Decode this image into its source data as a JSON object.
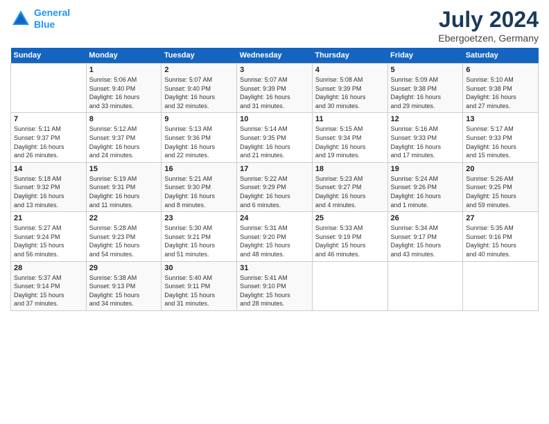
{
  "header": {
    "logo_line1": "General",
    "logo_line2": "Blue",
    "title": "July 2024",
    "subtitle": "Ebergoetzen, Germany"
  },
  "days_of_week": [
    "Sunday",
    "Monday",
    "Tuesday",
    "Wednesday",
    "Thursday",
    "Friday",
    "Saturday"
  ],
  "weeks": [
    [
      {
        "day": "",
        "info": ""
      },
      {
        "day": "1",
        "info": "Sunrise: 5:06 AM\nSunset: 9:40 PM\nDaylight: 16 hours\nand 33 minutes."
      },
      {
        "day": "2",
        "info": "Sunrise: 5:07 AM\nSunset: 9:40 PM\nDaylight: 16 hours\nand 32 minutes."
      },
      {
        "day": "3",
        "info": "Sunrise: 5:07 AM\nSunset: 9:39 PM\nDaylight: 16 hours\nand 31 minutes."
      },
      {
        "day": "4",
        "info": "Sunrise: 5:08 AM\nSunset: 9:39 PM\nDaylight: 16 hours\nand 30 minutes."
      },
      {
        "day": "5",
        "info": "Sunrise: 5:09 AM\nSunset: 9:38 PM\nDaylight: 16 hours\nand 29 minutes."
      },
      {
        "day": "6",
        "info": "Sunrise: 5:10 AM\nSunset: 9:38 PM\nDaylight: 16 hours\nand 27 minutes."
      }
    ],
    [
      {
        "day": "7",
        "info": "Sunrise: 5:11 AM\nSunset: 9:37 PM\nDaylight: 16 hours\nand 26 minutes."
      },
      {
        "day": "8",
        "info": "Sunrise: 5:12 AM\nSunset: 9:37 PM\nDaylight: 16 hours\nand 24 minutes."
      },
      {
        "day": "9",
        "info": "Sunrise: 5:13 AM\nSunset: 9:36 PM\nDaylight: 16 hours\nand 22 minutes."
      },
      {
        "day": "10",
        "info": "Sunrise: 5:14 AM\nSunset: 9:35 PM\nDaylight: 16 hours\nand 21 minutes."
      },
      {
        "day": "11",
        "info": "Sunrise: 5:15 AM\nSunset: 9:34 PM\nDaylight: 16 hours\nand 19 minutes."
      },
      {
        "day": "12",
        "info": "Sunrise: 5:16 AM\nSunset: 9:33 PM\nDaylight: 16 hours\nand 17 minutes."
      },
      {
        "day": "13",
        "info": "Sunrise: 5:17 AM\nSunset: 9:33 PM\nDaylight: 16 hours\nand 15 minutes."
      }
    ],
    [
      {
        "day": "14",
        "info": "Sunrise: 5:18 AM\nSunset: 9:32 PM\nDaylight: 16 hours\nand 13 minutes."
      },
      {
        "day": "15",
        "info": "Sunrise: 5:19 AM\nSunset: 9:31 PM\nDaylight: 16 hours\nand 11 minutes."
      },
      {
        "day": "16",
        "info": "Sunrise: 5:21 AM\nSunset: 9:30 PM\nDaylight: 16 hours\nand 8 minutes."
      },
      {
        "day": "17",
        "info": "Sunrise: 5:22 AM\nSunset: 9:29 PM\nDaylight: 16 hours\nand 6 minutes."
      },
      {
        "day": "18",
        "info": "Sunrise: 5:23 AM\nSunset: 9:27 PM\nDaylight: 16 hours\nand 4 minutes."
      },
      {
        "day": "19",
        "info": "Sunrise: 5:24 AM\nSunset: 9:26 PM\nDaylight: 16 hours\nand 1 minute."
      },
      {
        "day": "20",
        "info": "Sunrise: 5:26 AM\nSunset: 9:25 PM\nDaylight: 15 hours\nand 59 minutes."
      }
    ],
    [
      {
        "day": "21",
        "info": "Sunrise: 5:27 AM\nSunset: 9:24 PM\nDaylight: 15 hours\nand 56 minutes."
      },
      {
        "day": "22",
        "info": "Sunrise: 5:28 AM\nSunset: 9:23 PM\nDaylight: 15 hours\nand 54 minutes."
      },
      {
        "day": "23",
        "info": "Sunrise: 5:30 AM\nSunset: 9:21 PM\nDaylight: 15 hours\nand 51 minutes."
      },
      {
        "day": "24",
        "info": "Sunrise: 5:31 AM\nSunset: 9:20 PM\nDaylight: 15 hours\nand 48 minutes."
      },
      {
        "day": "25",
        "info": "Sunrise: 5:33 AM\nSunset: 9:19 PM\nDaylight: 15 hours\nand 46 minutes."
      },
      {
        "day": "26",
        "info": "Sunrise: 5:34 AM\nSunset: 9:17 PM\nDaylight: 15 hours\nand 43 minutes."
      },
      {
        "day": "27",
        "info": "Sunrise: 5:35 AM\nSunset: 9:16 PM\nDaylight: 15 hours\nand 40 minutes."
      }
    ],
    [
      {
        "day": "28",
        "info": "Sunrise: 5:37 AM\nSunset: 9:14 PM\nDaylight: 15 hours\nand 37 minutes."
      },
      {
        "day": "29",
        "info": "Sunrise: 5:38 AM\nSunset: 9:13 PM\nDaylight: 15 hours\nand 34 minutes."
      },
      {
        "day": "30",
        "info": "Sunrise: 5:40 AM\nSunset: 9:11 PM\nDaylight: 15 hours\nand 31 minutes."
      },
      {
        "day": "31",
        "info": "Sunrise: 5:41 AM\nSunset: 9:10 PM\nDaylight: 15 hours\nand 28 minutes."
      },
      {
        "day": "",
        "info": ""
      },
      {
        "day": "",
        "info": ""
      },
      {
        "day": "",
        "info": ""
      }
    ]
  ]
}
